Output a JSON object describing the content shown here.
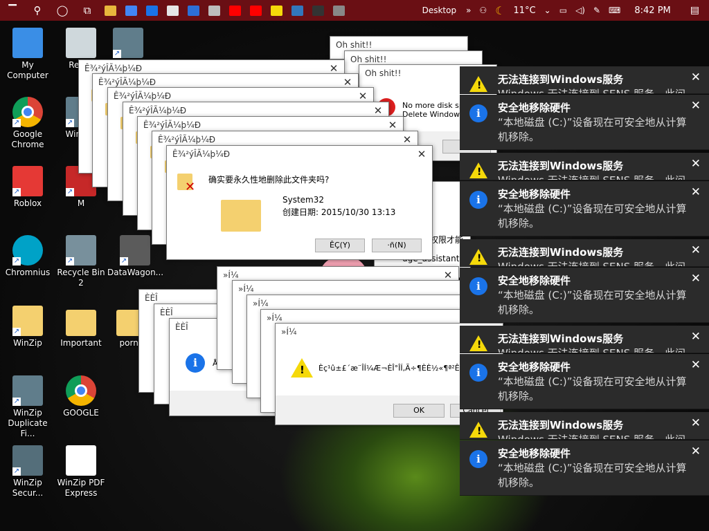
{
  "taskbar": {
    "desktop_label": "Desktop",
    "weather": "11°C",
    "clock": "8:42 PM",
    "apps": [
      {
        "icon": "file-explorer-icon",
        "color": "#e8b73c"
      },
      {
        "icon": "chrome-icon",
        "color": "#4285f4"
      },
      {
        "icon": "store-icon",
        "color": "#1a73e8"
      },
      {
        "icon": "roblox-icon",
        "color": "#e6e6e6"
      },
      {
        "icon": "monitor-app-icon",
        "color": "#2d6fd6"
      },
      {
        "icon": "photos-icon",
        "color": "#bdbdbd"
      },
      {
        "icon": "youtube-icon",
        "color": "#ff0000"
      },
      {
        "icon": "youtube-icon",
        "color": "#ff0000"
      },
      {
        "icon": "sticky-notes-icon",
        "color": "#f5d90a"
      },
      {
        "icon": "edge-icon",
        "color": "#3277bc"
      },
      {
        "icon": "7zip-icon",
        "color": "#333333"
      },
      {
        "icon": "tray-app-icon",
        "color": "#888888"
      }
    ]
  },
  "desktop_icons": [
    {
      "label": "My Computer",
      "icon": "computer-icon",
      "color": "#3a8ee6"
    },
    {
      "label": "Recyc",
      "icon": "recycle-bin-icon",
      "color": "#cfd8dc"
    },
    {
      "label": "",
      "icon": "share-shortcut-icon",
      "color": "#607d8b"
    },
    {
      "label": "Google Chrome",
      "icon": "chrome-icon",
      "color": "#db4437"
    },
    {
      "label": "WinZ M",
      "icon": "winzip-icon",
      "color": "#607d8b"
    },
    {
      "label": "Roblox",
      "icon": "roblox-icon",
      "color": "#e53935"
    },
    {
      "label": "M",
      "icon": "app-icon",
      "color": "#c62828"
    },
    {
      "label": "Chromnius",
      "icon": "chromnius-icon",
      "color": "#00a2c7"
    },
    {
      "label": "Recycle Bin 2",
      "icon": "recycle-bin-icon",
      "color": "#78909c"
    },
    {
      "label": "DataWagon...",
      "icon": "app-icon",
      "color": "#5b5b5b"
    },
    {
      "label": "WinZip",
      "icon": "winzip-icon",
      "color": "#f4d06f"
    },
    {
      "label": "Important",
      "icon": "folder-icon",
      "color": "#f4d06f"
    },
    {
      "label": "pornh",
      "icon": "folder-icon",
      "color": "#f4d06f"
    },
    {
      "label": "WinZip Duplicate Fi...",
      "icon": "winzip-duplicate-icon",
      "color": "#607d8b"
    },
    {
      "label": "GOOGLE",
      "icon": "chrome-icon",
      "color": "#db4437"
    },
    {
      "label": "WinZip Secur...",
      "icon": "winzip-secure-icon",
      "color": "#546e7a"
    },
    {
      "label": "WinZip PDF Express",
      "icon": "pdf-icon",
      "color": "#ffffff"
    }
  ],
  "delete_dialog": {
    "title": "Ê¾²ýÎÃ¼þ¼Ð",
    "question": "确实要永久性地删除此文件夹吗?",
    "folder_name": "System32",
    "created": "创建日期: 2015/10/30 13:13",
    "yes_button": "ÊÇ(Y)",
    "no_button": "·ñ(N)"
  },
  "ohshit_dialog": {
    "title": "Oh shit!!",
    "line1": "No more disk sp",
    "line2": "Delete Windows",
    "ok_button": "OK"
  },
  "behind_fragments": {
    "text1": "权限才能",
    "text2": "uge_assistant.e"
  },
  "dialog_title_3": "ÈÈÎ",
  "dialog_text_3": "Å",
  "dialog_title_4": "»­Í¼",
  "dialog_text_4": "Èç¹û±£´æ¨ÎÍ¼Æ¬ÈÎ°ÎÍ,Ã÷¶ÈÈ½«¶ª²Ê§¡£ÊÇ·ñ",
  "dialog_4_ok": "OK",
  "dialog_4_cancel": "Cancel",
  "notifications": {
    "warn_title": "无法连接到Windows服务",
    "warn_body": "Windows 无法连接到 SENS 服务。此问",
    "info_title": "安全地移除硬件",
    "info_body": "“本地磁盘 (C:)”设备现在可安全地从计算机移除。"
  },
  "colors": {
    "taskbar": "#6a0f14",
    "toast_bg": "#2b2b2b",
    "warning": "#f5d90a",
    "info": "#1a73e8"
  }
}
